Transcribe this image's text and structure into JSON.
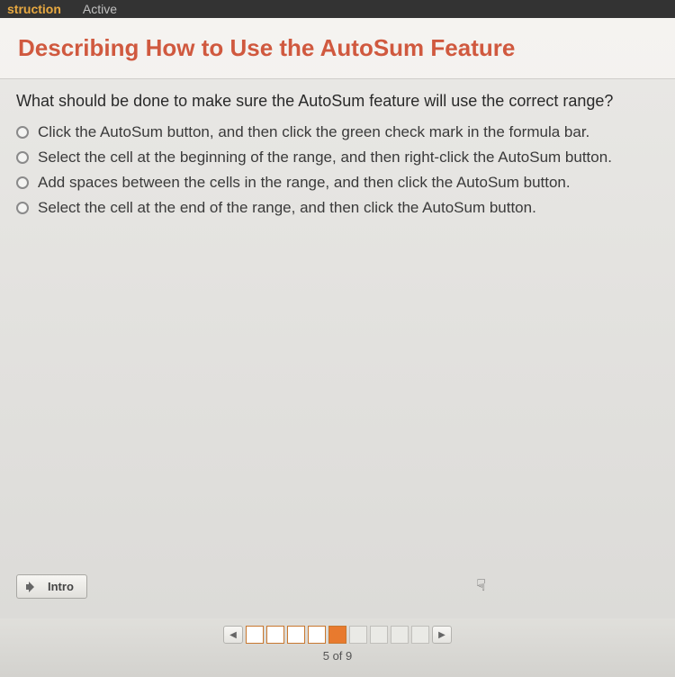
{
  "tabs": {
    "left": "struction",
    "right": "Active"
  },
  "title": "Describing How to Use the AutoSum Feature",
  "question": "What should be done to make sure the AutoSum feature will use the correct range?",
  "options": [
    "Click the AutoSum button, and then click the green check mark in the formula bar.",
    "Select the cell at the beginning of the range, and then right-click the AutoSum button.",
    "Add spaces between the cells in the range, and then click the AutoSum button.",
    "Select the cell at the end of the range, and then click the AutoSum button."
  ],
  "intro_label": "Intro",
  "pager": {
    "prev": "◀",
    "next": "▶",
    "total": 9,
    "current": 5,
    "label": "5 of 9"
  }
}
